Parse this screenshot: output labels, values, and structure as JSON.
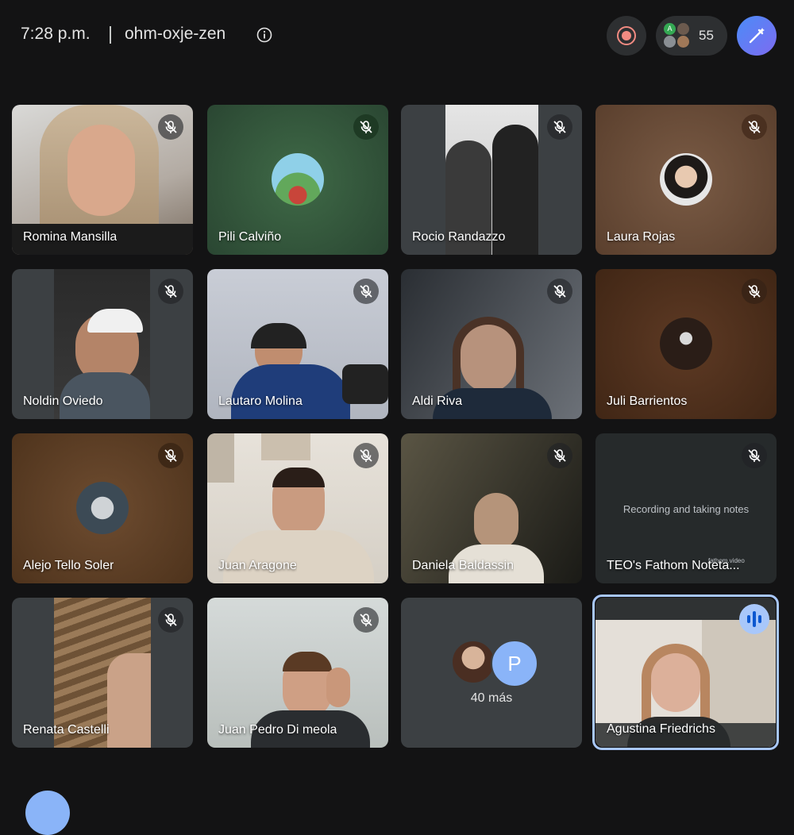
{
  "header": {
    "time": "7:28 p.m.",
    "meeting_code": "ohm-oxje-zen",
    "participant_count": "55",
    "avatar_letter": "A"
  },
  "colors": {
    "background": "#131314",
    "tile": "#3c4043",
    "accent": "#a8c7fa",
    "recording": "#f28b82"
  },
  "participants": [
    {
      "name": "Romina Mansilla",
      "muted": true
    },
    {
      "name": "Pili Calviño",
      "muted": true
    },
    {
      "name": "Rocio Randazzo",
      "muted": true
    },
    {
      "name": "Laura Rojas",
      "muted": true
    },
    {
      "name": "Noldin Oviedo",
      "muted": true
    },
    {
      "name": "Lautaro Molina",
      "muted": true
    },
    {
      "name": "Aldi Riva",
      "muted": true
    },
    {
      "name": "Juli Barrientos",
      "muted": true
    },
    {
      "name": "Alejo Tello Soler",
      "muted": true
    },
    {
      "name": "Juan Aragone",
      "muted": true
    },
    {
      "name": "Daniela Baldassin",
      "muted": true
    },
    {
      "name": "TEO's Fathom Noteta...",
      "muted": true,
      "status_text": "Recording and taking notes",
      "link_text": "fathom.video"
    },
    {
      "name": "Renata Castelli",
      "muted": true
    },
    {
      "name": "Juan Pedro Di meola",
      "muted": true
    },
    {
      "name": "Agustina Friedrichs",
      "muted": false,
      "speaking": true
    }
  ],
  "overflow": {
    "avatar_letter": "P",
    "more_label": "40 más"
  }
}
